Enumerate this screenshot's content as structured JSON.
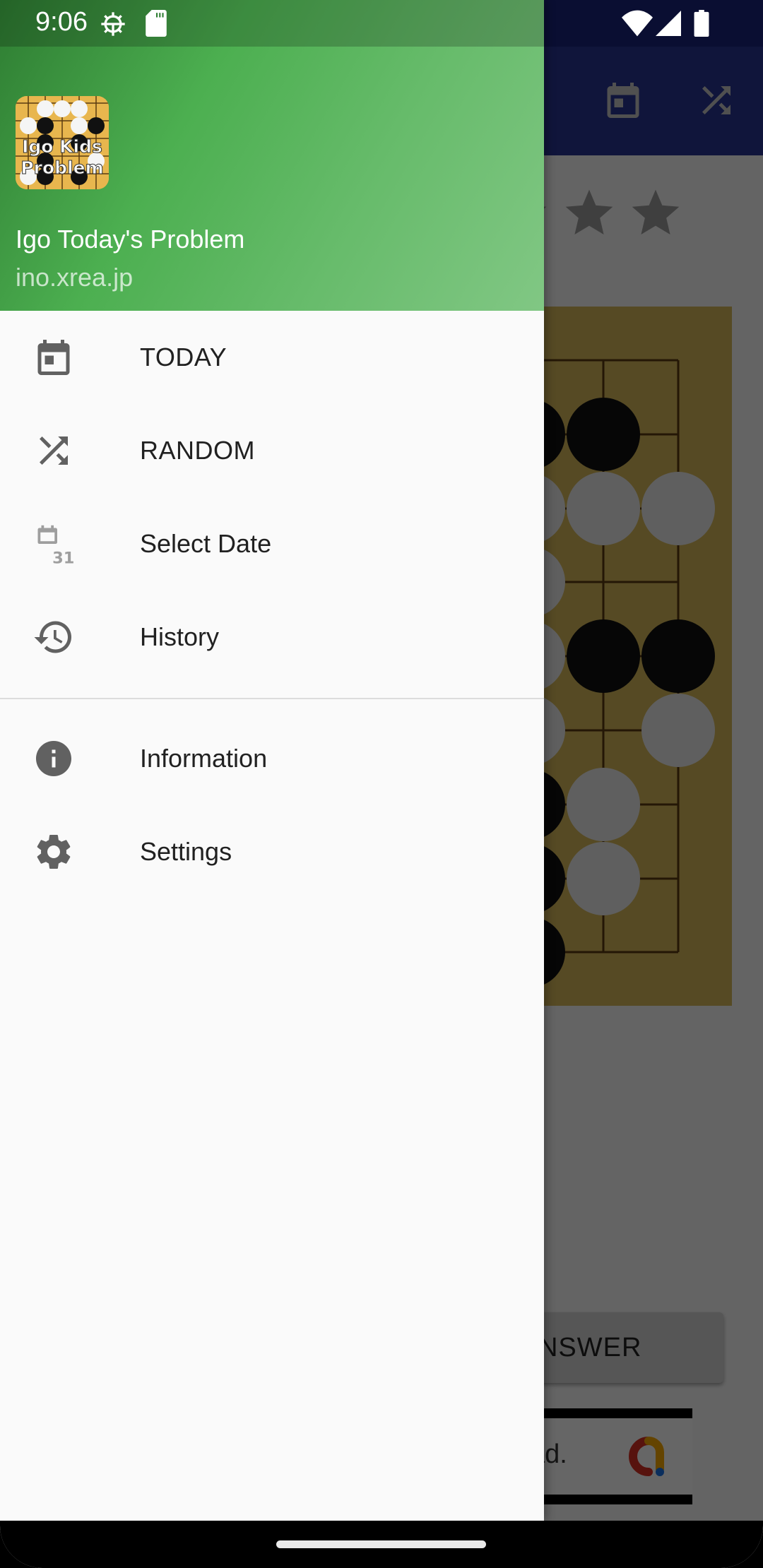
{
  "status_bar": {
    "time": "9:06",
    "left_icons": [
      "android-debug-icon",
      "sd-card-icon"
    ],
    "right_icons": [
      "wifi-icon",
      "cellular-signal-icon",
      "battery-icon"
    ]
  },
  "drawer": {
    "header": {
      "logo_text_line1": "Igo Kids",
      "logo_text_line2": "Problem",
      "title": "Igo Today's Problem",
      "subtitle": "ino.xrea.jp"
    },
    "primary_items": [
      {
        "label": "TODAY",
        "icon": "calendar-today-icon"
      },
      {
        "label": "RANDOM",
        "icon": "shuffle-icon"
      },
      {
        "label": "Select Date",
        "icon": "calendar-31-icon"
      },
      {
        "label": "History",
        "icon": "history-icon"
      }
    ],
    "secondary_items": [
      {
        "label": "Information",
        "icon": "info-icon"
      },
      {
        "label": "Settings",
        "icon": "settings-icon"
      }
    ]
  },
  "background_app": {
    "toolbar_icons": [
      "calendar-today-icon",
      "shuffle-icon"
    ],
    "difficulty_stars_visible": 3,
    "answer_button_label": "ANSWER",
    "ad_text_fragment": "ad."
  },
  "colors": {
    "drawer_header_green": "#4caf50",
    "toolbar_indigo": "#283593",
    "icon_gray": "#616161",
    "board_wood": "#d7b95a"
  }
}
